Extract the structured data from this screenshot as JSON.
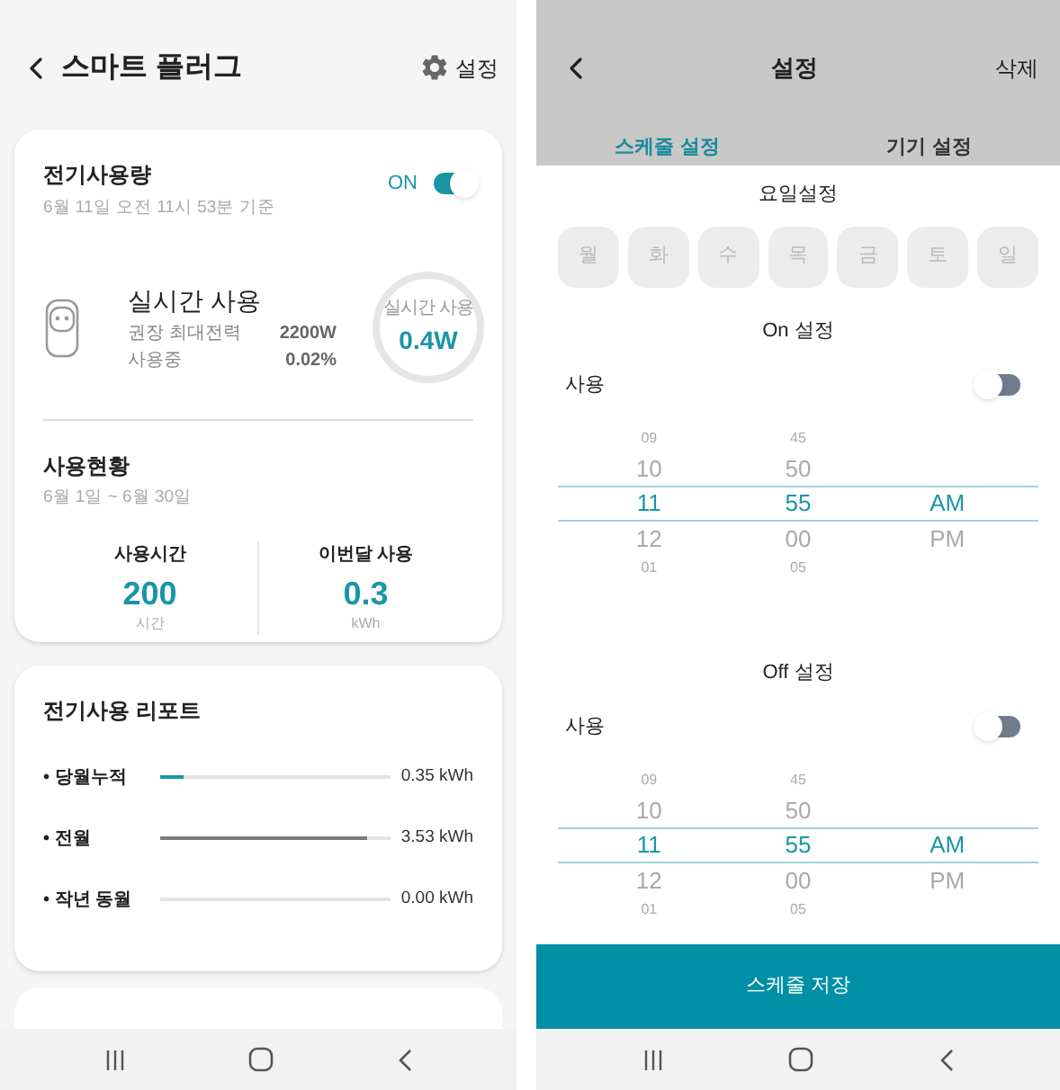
{
  "left": {
    "header": {
      "title": "스마트 플러그",
      "settings_label": "설정"
    },
    "usage_card": {
      "title": "전기사용량",
      "timestamp": "6월 11일 오전 11시 53분 기준",
      "power_label": "ON",
      "power_on": true,
      "realtime": {
        "title": "실시간 사용",
        "rows": [
          {
            "label": "권장 최대전력",
            "value": "2200W"
          },
          {
            "label": "사용중",
            "value": "0.02%"
          }
        ],
        "gauge_label": "실시간 사용",
        "gauge_value": "0.4W"
      },
      "status": {
        "title": "사용현황",
        "period": "6월 1일 ~ 6월 30일",
        "stats": [
          {
            "label": "사용시간",
            "value": "200",
            "unit": "시간"
          },
          {
            "label": "이번달 사용",
            "value": "0.3",
            "unit": "kWh"
          }
        ]
      }
    },
    "report_card": {
      "title": "전기사용 리포트",
      "rows": [
        {
          "label": "• 당월누적",
          "level": 0.1,
          "value": "0.35 kWh",
          "color": "#1a95a8"
        },
        {
          "label": "• 전월",
          "level": 0.9,
          "value": "3.53 kWh",
          "color": "#7a7a7a"
        },
        {
          "label": "• 작년 동월",
          "level": 0,
          "value": "0.00 kWh"
        }
      ]
    }
  },
  "right": {
    "header": {
      "title": "설정",
      "action": "삭제"
    },
    "tabs": [
      {
        "label": "스케줄 설정",
        "selected": true
      },
      {
        "label": "기기 설정",
        "selected": false
      }
    ],
    "weekday_title": "요일설정",
    "days": [
      {
        "label": "월",
        "selected": false
      },
      {
        "label": "화",
        "selected": false
      },
      {
        "label": "수",
        "selected": false
      },
      {
        "label": "목",
        "selected": false
      },
      {
        "label": "금",
        "selected": false
      },
      {
        "label": "토",
        "selected": false
      },
      {
        "label": "일",
        "selected": false
      }
    ],
    "schedules": [
      {
        "title": "On 설정",
        "enable_label": "사용",
        "enabled": false,
        "columns": [
          {
            "above": [
              "09",
              "10"
            ],
            "selected": "11",
            "below": [
              "12",
              "01"
            ]
          },
          {
            "above": [
              "45",
              "50"
            ],
            "selected": "55",
            "below": [
              "00",
              "05"
            ]
          },
          {
            "selected": "AM",
            "below": [
              "PM"
            ]
          }
        ]
      },
      {
        "title": "Off 설정",
        "enable_label": "사용",
        "enabled": false,
        "columns": [
          {
            "above": [
              "09",
              "10"
            ],
            "selected": "11",
            "below": [
              "12",
              "01"
            ]
          },
          {
            "above": [
              "45",
              "50"
            ],
            "selected": "55",
            "below": [
              "00",
              "05"
            ]
          },
          {
            "selected": "AM",
            "below": [
              "PM"
            ]
          }
        ]
      }
    ],
    "save_button": "스케줄 저장"
  }
}
